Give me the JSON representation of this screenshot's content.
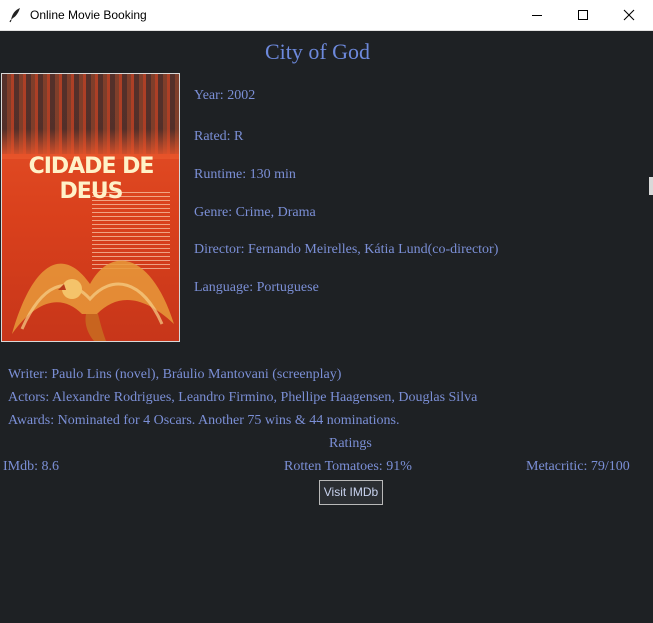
{
  "window": {
    "title": "Online Movie Booking"
  },
  "movie": {
    "title": "City of God",
    "poster_text": "CIDADE DE DEUS",
    "year": "Year: 2002",
    "rated": "Rated: R",
    "runtime": "Runtime: 130 min",
    "genre": "Genre: Crime, Drama",
    "director": "Director: Fernando Meirelles, Kátia Lund(co-director)",
    "language": "Language: Portuguese",
    "writer": "Writer: Paulo Lins (novel), Bráulio Mantovani (screenplay)",
    "actors": "Actors: Alexandre Rodrigues, Leandro Firmino, Phellipe Haagensen, Douglas Silva",
    "awards": "Awards: Nominated for 4 Oscars. Another 75 wins & 44 nominations."
  },
  "ratings": {
    "label": "Ratings",
    "imdb": "IMdb: 8.6",
    "rotten_tomatoes": "Rotten Tomatoes: 91%",
    "metacritic": "Metacritic: 79/100"
  },
  "actions": {
    "visit_imdb": "Visit IMDb"
  },
  "icons": {
    "app": "feather-icon",
    "minimize": "minimize-icon",
    "maximize": "maximize-icon",
    "close": "close-icon"
  },
  "colors": {
    "background": "#1e2124",
    "text": "#7b8fd6",
    "title": "#6d89dc"
  }
}
